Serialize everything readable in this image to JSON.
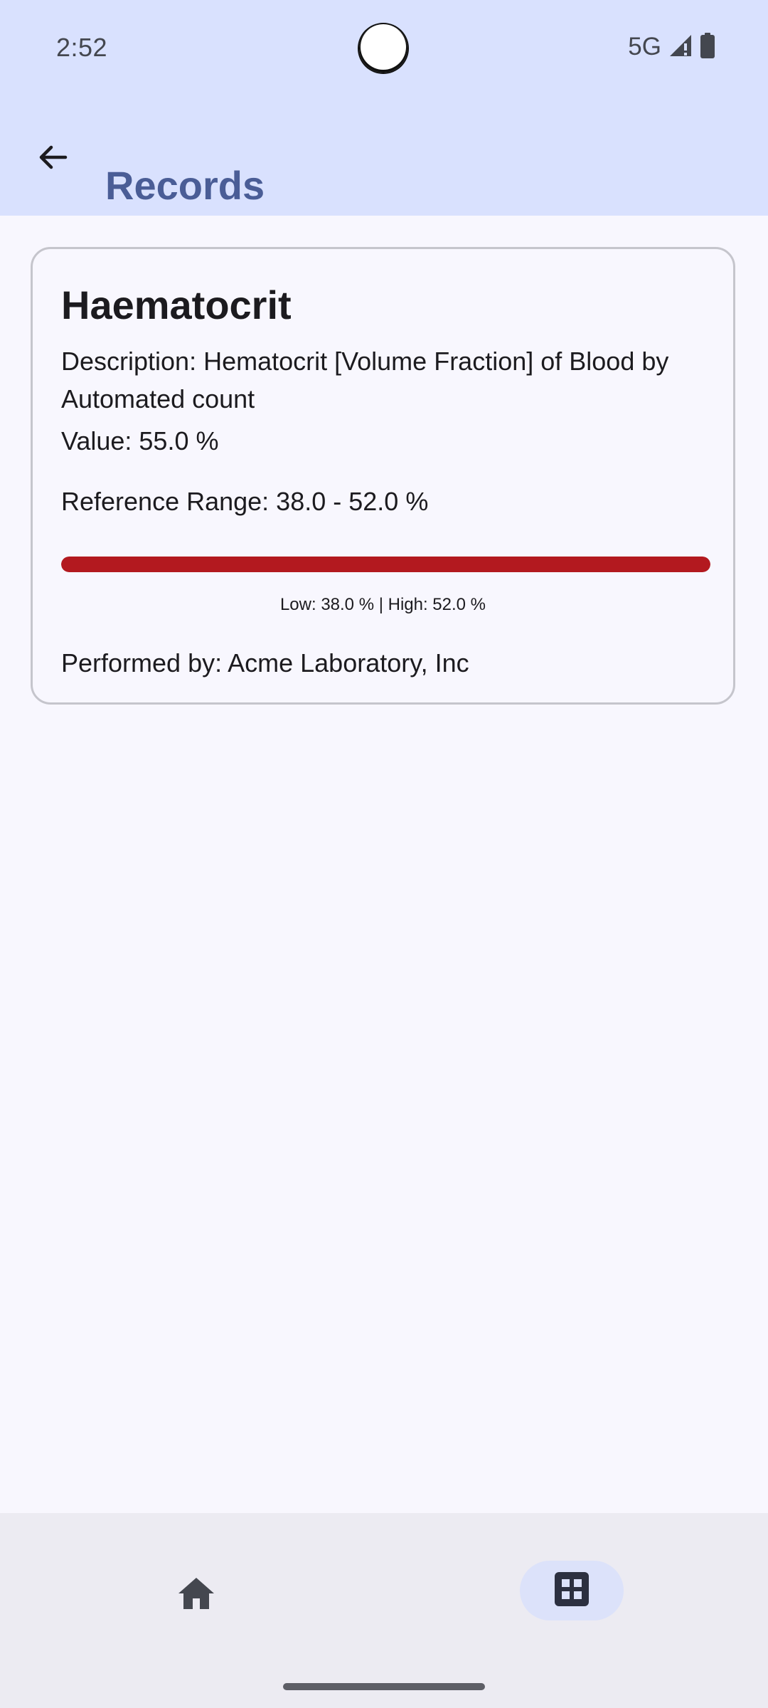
{
  "status_bar": {
    "time": "2:52",
    "network": "5G",
    "icons": [
      "signal-icon",
      "battery-icon"
    ]
  },
  "app_bar": {
    "back_icon": "arrow-back-icon",
    "title": "Records"
  },
  "record": {
    "title": "Haematocrit",
    "description": "Description: Hematocrit [Volume Fraction] of Blood by Automated count",
    "value": "Value: 55.0 %",
    "reference_range": "Reference Range: 38.0 - 52.0 %",
    "range_bar_fill": 1.0,
    "range_caption": "Low: 38.0 % | High: 52.0 %",
    "performed_by": "Performed by: Acme Laboratory, Inc"
  },
  "bottom_nav": {
    "items": [
      {
        "icon": "home-icon",
        "selected": false
      },
      {
        "icon": "grid-icon",
        "selected": true
      }
    ]
  },
  "colors": {
    "app_bar_background": "#d9e1fe",
    "title_color": "#4a5d96",
    "range_bar_out_of_range": "#b3191f",
    "nav_selected_indicator": "#dce2fa"
  }
}
